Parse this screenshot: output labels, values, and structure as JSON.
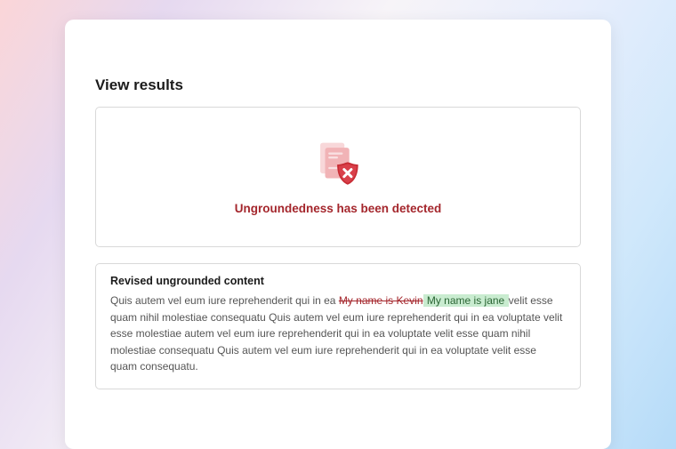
{
  "page": {
    "title": "View results"
  },
  "detection": {
    "icon_name": "document-error-shield-icon",
    "message": "Ungroundedness has been detected"
  },
  "revised": {
    "title": "Revised ungrounded content",
    "segments": {
      "before": "Quis autem vel eum iure reprehenderit qui in ea ",
      "struck": "My name is Kevin",
      "highlighted": " My name is jane ",
      "after": "velit esse quam nihil molestiae consequatu Quis autem vel eum iure reprehenderit qui in ea voluptate velit esse molestiae  autem vel eum iure reprehenderit qui in ea voluptate velit esse quam nihil molestiae consequatu Quis autem vel eum iure reprehenderit qui in ea voluptate velit esse quam consequatu."
    }
  }
}
